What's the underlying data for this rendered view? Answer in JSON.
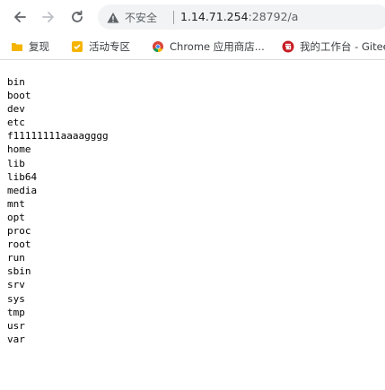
{
  "toolbar": {
    "back_icon": "arrow-left-icon",
    "forward_icon": "arrow-right-icon",
    "reload_icon": "reload-icon",
    "security_icon": "warning-triangle-icon",
    "security_label": "不安全",
    "url_host": "1.14.71.254",
    "url_rest": ":28792/a"
  },
  "bookmarks": [
    {
      "label": "复现",
      "icon": "folder-icon",
      "color": "#f5b400"
    },
    {
      "label": "活动专区",
      "icon": "yellow-square-icon",
      "color": "#f5b400"
    },
    {
      "label": "Chrome 应用商店...",
      "icon": "chrome-icon",
      "color": "#db4437"
    },
    {
      "label": "我的工作台 - Gitee",
      "icon": "gitee-icon",
      "color": "#c71d23"
    }
  ],
  "listing": [
    "bin",
    "boot",
    "dev",
    "etc",
    "f11111111aaaagggg",
    "home",
    "lib",
    "lib64",
    "media",
    "mnt",
    "opt",
    "proc",
    "root",
    "run",
    "sbin",
    "srv",
    "sys",
    "tmp",
    "usr",
    "var"
  ]
}
